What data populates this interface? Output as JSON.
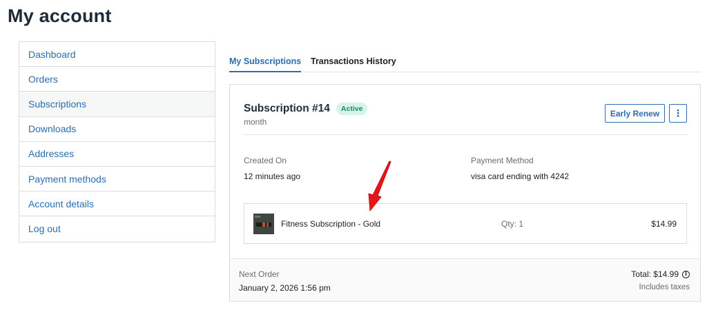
{
  "page": {
    "title": "My account"
  },
  "nav": {
    "items": [
      {
        "label": "Dashboard"
      },
      {
        "label": "Orders"
      },
      {
        "label": "Subscriptions"
      },
      {
        "label": "Downloads"
      },
      {
        "label": "Addresses"
      },
      {
        "label": "Payment methods"
      },
      {
        "label": "Account details"
      },
      {
        "label": "Log out"
      }
    ],
    "active": "Subscriptions"
  },
  "tabs": [
    {
      "label": "My Subscriptions",
      "active": true
    },
    {
      "label": "Transactions History",
      "active": false
    }
  ],
  "subscription": {
    "title": "Subscription #14",
    "status": "Active",
    "period": "month",
    "early_renew_label": "Early Renew",
    "more_label": "⋮",
    "created_label": "Created On",
    "created_value": "12 minutes ago",
    "payment_label": "Payment Method",
    "payment_value": "visa card ending with 4242",
    "item": {
      "name": "Fitness Subscription - Gold",
      "qty": "Qty: 1",
      "price": "$14.99"
    },
    "next_order_label": "Next Order",
    "next_order_value": "January 2, 2026 1:56 pm",
    "total": "Total: $14.99",
    "taxes": "Includes taxes"
  },
  "colors": {
    "accent": "#2a6db0",
    "badge_bg": "#d6f4ea",
    "badge_text": "#1c8a5c",
    "arrow": "#e8141b"
  },
  "icons": {
    "info": "info-circle-icon",
    "more": "vertical-ellipsis-icon",
    "annotation": "red-arrow-icon"
  }
}
